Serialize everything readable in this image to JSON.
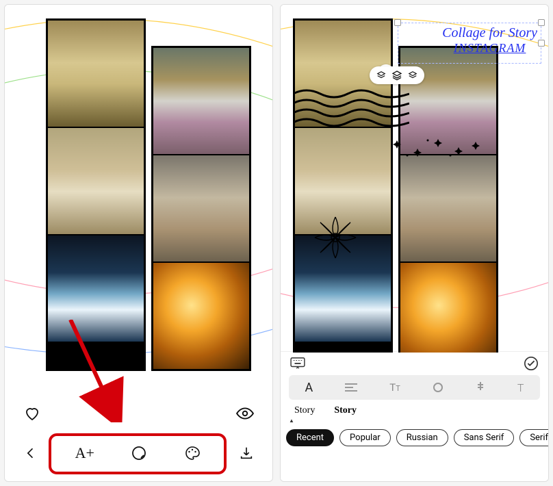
{
  "left": {
    "favorite_icon": "heart",
    "preview_icon": "eye",
    "back_icon": "chevron-left",
    "text_tool_label": "A+",
    "sticker_tool_icon": "sticker",
    "palette_tool_icon": "palette",
    "download_icon": "download"
  },
  "right": {
    "overlay_text_line1": "Collage for Story",
    "overlay_text_line2": "INSTAGRAM",
    "rotate_icon": "rotate",
    "layer_up_icon": "layer-up",
    "layers_icon": "layers",
    "layer_down_icon": "layer-down",
    "keyboard_icon": "keyboard",
    "confirm_icon": "check",
    "style_icons": [
      "A",
      "align",
      "case",
      "spacing",
      "color",
      "shadow"
    ],
    "style_active_index": 0,
    "font_preview_1": "Story",
    "font_preview_2": "Story",
    "chips": [
      "Recent",
      "Popular",
      "Russian",
      "Sans Serif",
      "Serif"
    ],
    "chip_active_index": 0
  }
}
